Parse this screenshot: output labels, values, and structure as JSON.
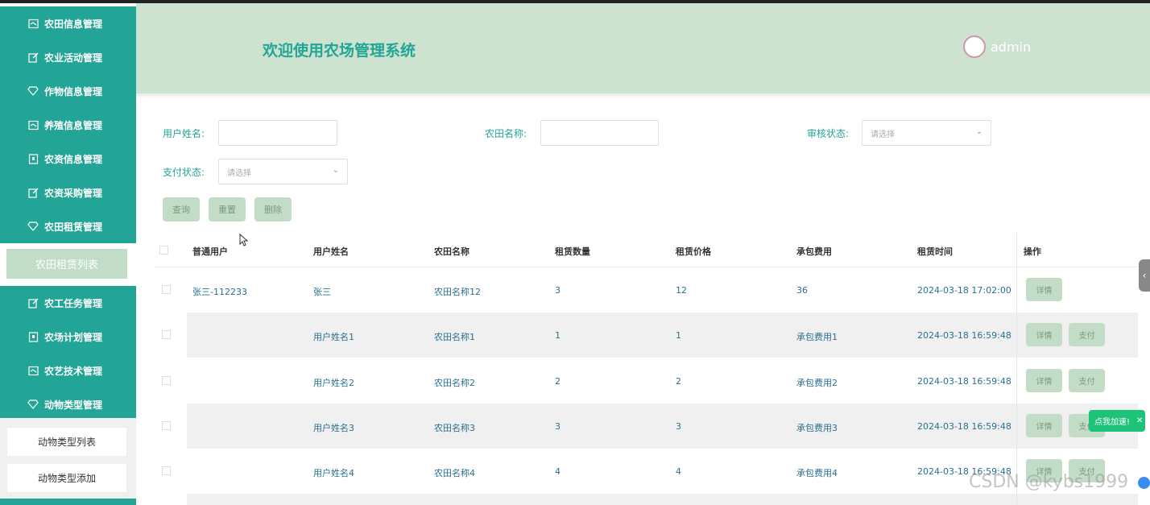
{
  "sidebar": {
    "items": [
      {
        "label": "农田信息管理",
        "icon": "table-icon"
      },
      {
        "label": "农业活动管理",
        "icon": "edit-icon"
      },
      {
        "label": "作物信息管理",
        "icon": "diamond-icon"
      },
      {
        "label": "养殖信息管理",
        "icon": "table-icon"
      },
      {
        "label": "农资信息管理",
        "icon": "doc-icon"
      },
      {
        "label": "农资采购管理",
        "icon": "edit-icon"
      },
      {
        "label": "农田租赁管理",
        "icon": "diamond-icon"
      }
    ],
    "active_sub": "农田租赁列表",
    "items2": [
      {
        "label": "农工任务管理",
        "icon": "edit-icon"
      },
      {
        "label": "农场计划管理",
        "icon": "doc-icon"
      },
      {
        "label": "农艺技术管理",
        "icon": "table-icon"
      },
      {
        "label": "动物类型管理",
        "icon": "diamond-icon"
      }
    ],
    "subs": [
      "动物类型列表",
      "动物类型添加"
    ]
  },
  "header": {
    "title": "欢迎使用农场管理系统",
    "user": "admin"
  },
  "filters": {
    "username_label": "用户姓名:",
    "farm_label": "农田名称:",
    "review_label": "审核状态:",
    "review_placeholder": "请选择",
    "pay_label": "支付状态:",
    "pay_placeholder": "请选择"
  },
  "actions": {
    "query": "查询",
    "reset": "重置",
    "delete": "删除"
  },
  "table": {
    "headers": [
      "普通用户",
      "用户姓名",
      "农田名称",
      "租赁数量",
      "租赁价格",
      "承包费用",
      "租赁时间",
      "操作"
    ],
    "rows": [
      {
        "user": "张三-112233",
        "name": "张三",
        "farm": "农田名称12",
        "qty": "3",
        "price": "12",
        "fee": "36",
        "time": "2024-03-18 17:02:00",
        "pay": false
      },
      {
        "user": "",
        "name": "用户姓名1",
        "farm": "农田名称1",
        "qty": "1",
        "price": "1",
        "fee": "承包费用1",
        "time": "2024-03-18 16:59:48",
        "pay": true
      },
      {
        "user": "",
        "name": "用户姓名2",
        "farm": "农田名称2",
        "qty": "2",
        "price": "2",
        "fee": "承包费用2",
        "time": "2024-03-18 16:59:48",
        "pay": true
      },
      {
        "user": "",
        "name": "用户姓名3",
        "farm": "农田名称3",
        "qty": "3",
        "price": "3",
        "fee": "承包费用3",
        "time": "2024-03-18 16:59:48",
        "pay": true
      },
      {
        "user": "",
        "name": "用户姓名4",
        "farm": "农田名称4",
        "qty": "4",
        "price": "4",
        "fee": "承包费用4",
        "time": "2024-03-18 16:59:48",
        "pay": true
      }
    ],
    "detail_label": "详情",
    "pay_label": "支付"
  },
  "toast": "点我加速!",
  "watermark": "CSDN @kybs1999",
  "colors": {
    "primary": "#22a597",
    "header_bg": "#cde3d0",
    "button_bg": "#c2dcc6"
  }
}
